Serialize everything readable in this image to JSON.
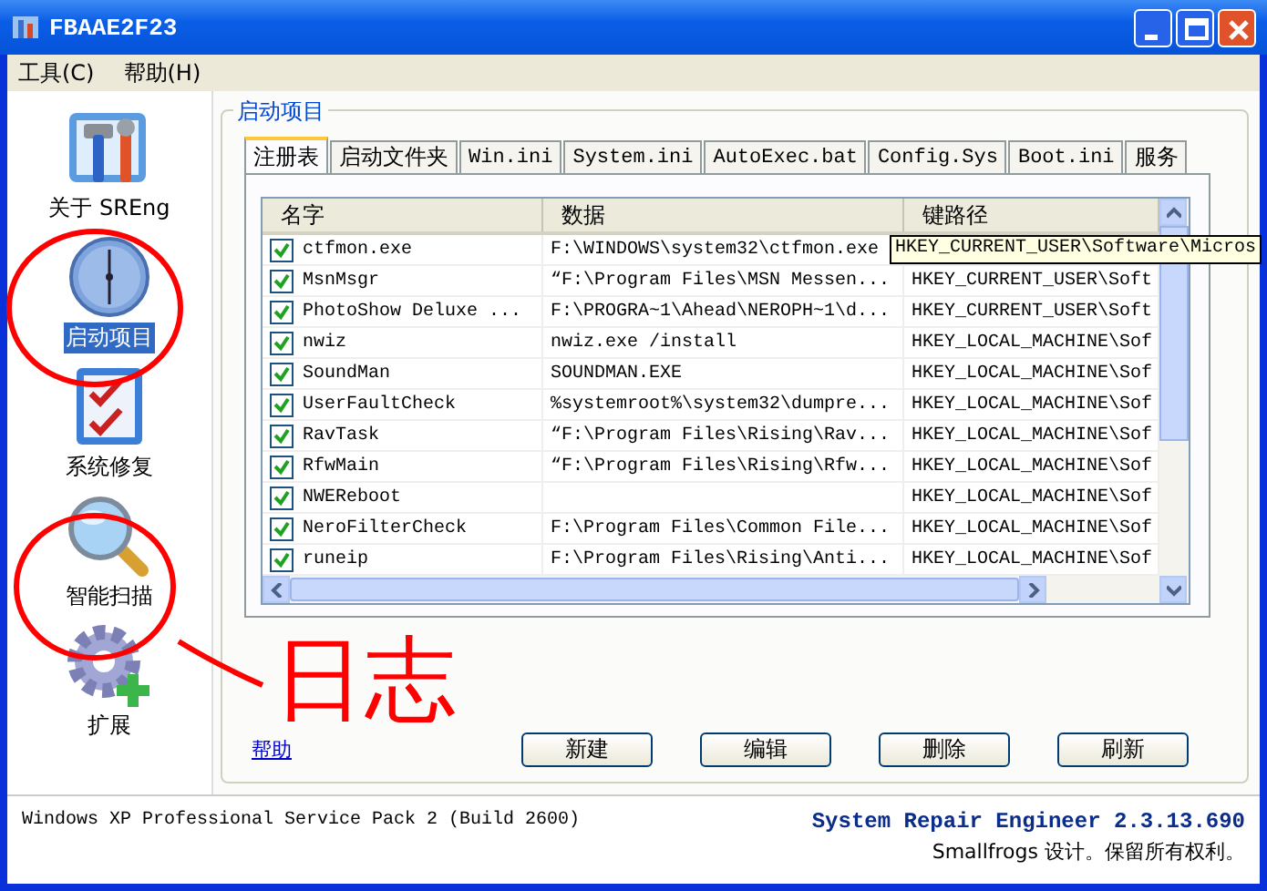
{
  "window": {
    "title": "FBAAE2F23"
  },
  "menu": [
    "工具(C)",
    "帮助(H)"
  ],
  "sidebar": {
    "items": [
      {
        "label": "关于 SREng",
        "kind": "tools",
        "selected": false
      },
      {
        "label": "启动项目",
        "kind": "clock",
        "selected": true
      },
      {
        "label": "系统修复",
        "kind": "checklist",
        "selected": false
      },
      {
        "label": "智能扫描",
        "kind": "magnifier",
        "selected": false
      },
      {
        "label": "扩展",
        "kind": "gear",
        "selected": false
      }
    ]
  },
  "group": {
    "title": "启动项目"
  },
  "tabs": [
    {
      "label": "注册表",
      "selected": true
    },
    {
      "label": "启动文件夹",
      "selected": false
    },
    {
      "label": "Win.ini",
      "selected": false
    },
    {
      "label": "System.ini",
      "selected": false
    },
    {
      "label": "AutoExec.bat",
      "selected": false
    },
    {
      "label": "Config.Sys",
      "selected": false
    },
    {
      "label": "Boot.ini",
      "selected": false
    },
    {
      "label": "服务",
      "selected": false
    }
  ],
  "table": {
    "columns": [
      "名字",
      "数据",
      "键路径"
    ],
    "rows": [
      {
        "checked": true,
        "name": "ctfmon.exe",
        "data": "F:\\WINDOWS\\system32\\ctfmon.exe"
      },
      {
        "checked": true,
        "name": "MsnMsgr",
        "data": "“F:\\Program Files\\MSN Messen...",
        "key": "HKEY_CURRENT_USER\\Soft"
      },
      {
        "checked": true,
        "name": "PhotoShow Deluxe ...",
        "data": "F:\\PROGRA~1\\Ahead\\NEROPH~1\\d...",
        "key": "HKEY_CURRENT_USER\\Soft"
      },
      {
        "checked": true,
        "name": "nwiz",
        "data": "nwiz.exe /install",
        "key": "HKEY_LOCAL_MACHINE\\Sof"
      },
      {
        "checked": true,
        "name": "SoundMan",
        "data": "SOUNDMAN.EXE",
        "key": "HKEY_LOCAL_MACHINE\\Sof"
      },
      {
        "checked": true,
        "name": "UserFaultCheck",
        "data": "%systemroot%\\system32\\dumpre...",
        "key": "HKEY_LOCAL_MACHINE\\Sof"
      },
      {
        "checked": true,
        "name": "RavTask",
        "data": "“F:\\Program Files\\Rising\\Rav...",
        "key": "HKEY_LOCAL_MACHINE\\Sof"
      },
      {
        "checked": true,
        "name": "RfwMain",
        "data": "“F:\\Program Files\\Rising\\Rfw...",
        "key": "HKEY_LOCAL_MACHINE\\Sof"
      },
      {
        "checked": true,
        "name": "NWEReboot",
        "key": "HKEY_LOCAL_MACHINE\\Sof"
      },
      {
        "checked": true,
        "name": "NeroFilterCheck",
        "data": "F:\\Program Files\\Common File...",
        "key": "HKEY_LOCAL_MACHINE\\Sof"
      },
      {
        "checked": true,
        "name": "runeip",
        "data": "F:\\Program Files\\Rising\\Anti...",
        "key": "HKEY_LOCAL_MACHINE\\Sof"
      }
    ],
    "tooltip": "HKEY_CURRENT_USER\\Software\\Micros"
  },
  "help_link": "帮助",
  "buttons": [
    "新建",
    "编辑",
    "删除",
    "刷新"
  ],
  "status": {
    "os": "Windows XP Professional Service Pack 2 (Build 2600)",
    "product": "System Repair Engineer 2.3.13.690",
    "copyright": "Smallfrogs 设计。保留所有权利。"
  },
  "annotation": {
    "text": "日志"
  }
}
